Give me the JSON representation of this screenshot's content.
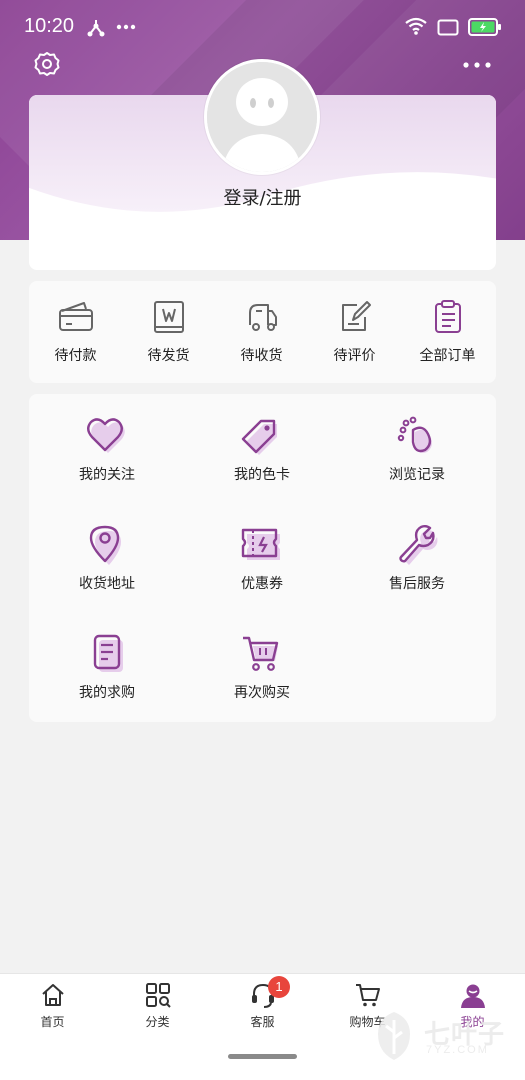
{
  "status_bar": {
    "time": "10:20"
  },
  "profile": {
    "login_label": "登录/注册"
  },
  "orders": [
    {
      "label": "待付款",
      "icon": "wallet-icon"
    },
    {
      "label": "待发货",
      "icon": "package-icon"
    },
    {
      "label": "待收货",
      "icon": "delivery-truck-icon"
    },
    {
      "label": "待评价",
      "icon": "review-edit-icon"
    },
    {
      "label": "全部订单",
      "icon": "clipboard-list-icon"
    }
  ],
  "services": [
    {
      "label": "我的关注",
      "icon": "heart-icon"
    },
    {
      "label": "我的色卡",
      "icon": "tag-icon"
    },
    {
      "label": "浏览记录",
      "icon": "footprint-icon"
    },
    {
      "label": "收货地址",
      "icon": "location-pin-icon"
    },
    {
      "label": "优惠券",
      "icon": "coupon-icon"
    },
    {
      "label": "售后服务",
      "icon": "wrench-icon"
    },
    {
      "label": "我的求购",
      "icon": "document-icon"
    },
    {
      "label": "再次购买",
      "icon": "cart-icon"
    }
  ],
  "bottom_nav": [
    {
      "label": "首页",
      "icon": "home-icon"
    },
    {
      "label": "分类",
      "icon": "category-grid-icon"
    },
    {
      "label": "客服",
      "icon": "headset-icon",
      "badge": "1"
    },
    {
      "label": "购物车",
      "icon": "cart-icon"
    },
    {
      "label": "我的",
      "icon": "user-icon",
      "active": true
    }
  ],
  "watermark": {
    "text": "七叶子",
    "sub": "7YZ.COM"
  },
  "colors": {
    "accent": "#8a3f92",
    "accent_light": "#e6cdeb",
    "badge": "#e8453c"
  }
}
